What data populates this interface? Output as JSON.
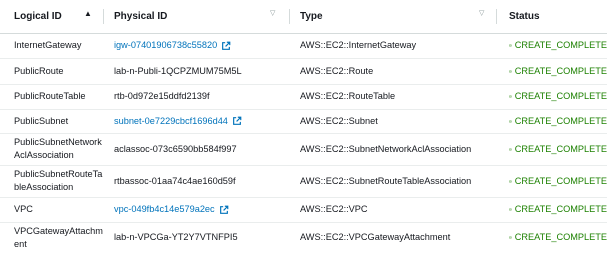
{
  "columns": {
    "logical_id": "Logical ID",
    "physical_id": "Physical ID",
    "type": "Type",
    "status": "Status"
  },
  "rows": [
    {
      "logical_id": "InternetGateway",
      "physical_id": "igw-07401906738c55820",
      "link": true,
      "type": "AWS::EC2::InternetGateway",
      "status": "CREATE_COMPLETE"
    },
    {
      "logical_id": "PublicRoute",
      "physical_id": "lab-n-Publi-1QCPZMUM75M5L",
      "link": false,
      "type": "AWS::EC2::Route",
      "status": "CREATE_COMPLETE"
    },
    {
      "logical_id": "PublicRouteTable",
      "physical_id": "rtb-0d972e15ddfd2139f",
      "link": false,
      "type": "AWS::EC2::RouteTable",
      "status": "CREATE_COMPLETE"
    },
    {
      "logical_id": "PublicSubnet",
      "physical_id": "subnet-0e7229cbcf1696d44",
      "link": true,
      "type": "AWS::EC2::Subnet",
      "status": "CREATE_COMPLETE"
    },
    {
      "logical_id": "PublicSubnetNetworkAclAssociation",
      "physical_id": "aclassoc-073c6590bb584f997",
      "link": false,
      "type": "AWS::EC2::SubnetNetworkAclAssociation",
      "status": "CREATE_COMPLETE"
    },
    {
      "logical_id": "PublicSubnetRouteTableAssociation",
      "physical_id": "rtbassoc-01aa74c4ae160d59f",
      "link": false,
      "type": "AWS::EC2::SubnetRouteTableAssociation",
      "status": "CREATE_COMPLETE"
    },
    {
      "logical_id": "VPC",
      "physical_id": "vpc-049fb4c14e579a2ec",
      "link": true,
      "type": "AWS::EC2::VPC",
      "status": "CREATE_COMPLETE"
    },
    {
      "logical_id": "VPCGatewayAttachment",
      "physical_id": "lab-n-VPCGa-YT2Y7VTNFPI5",
      "link": false,
      "type": "AWS::EC2::VPCGatewayAttachment",
      "status": "CREATE_COMPLETE"
    }
  ],
  "colors": {
    "link": "#0073bb",
    "success": "#1d8102"
  }
}
